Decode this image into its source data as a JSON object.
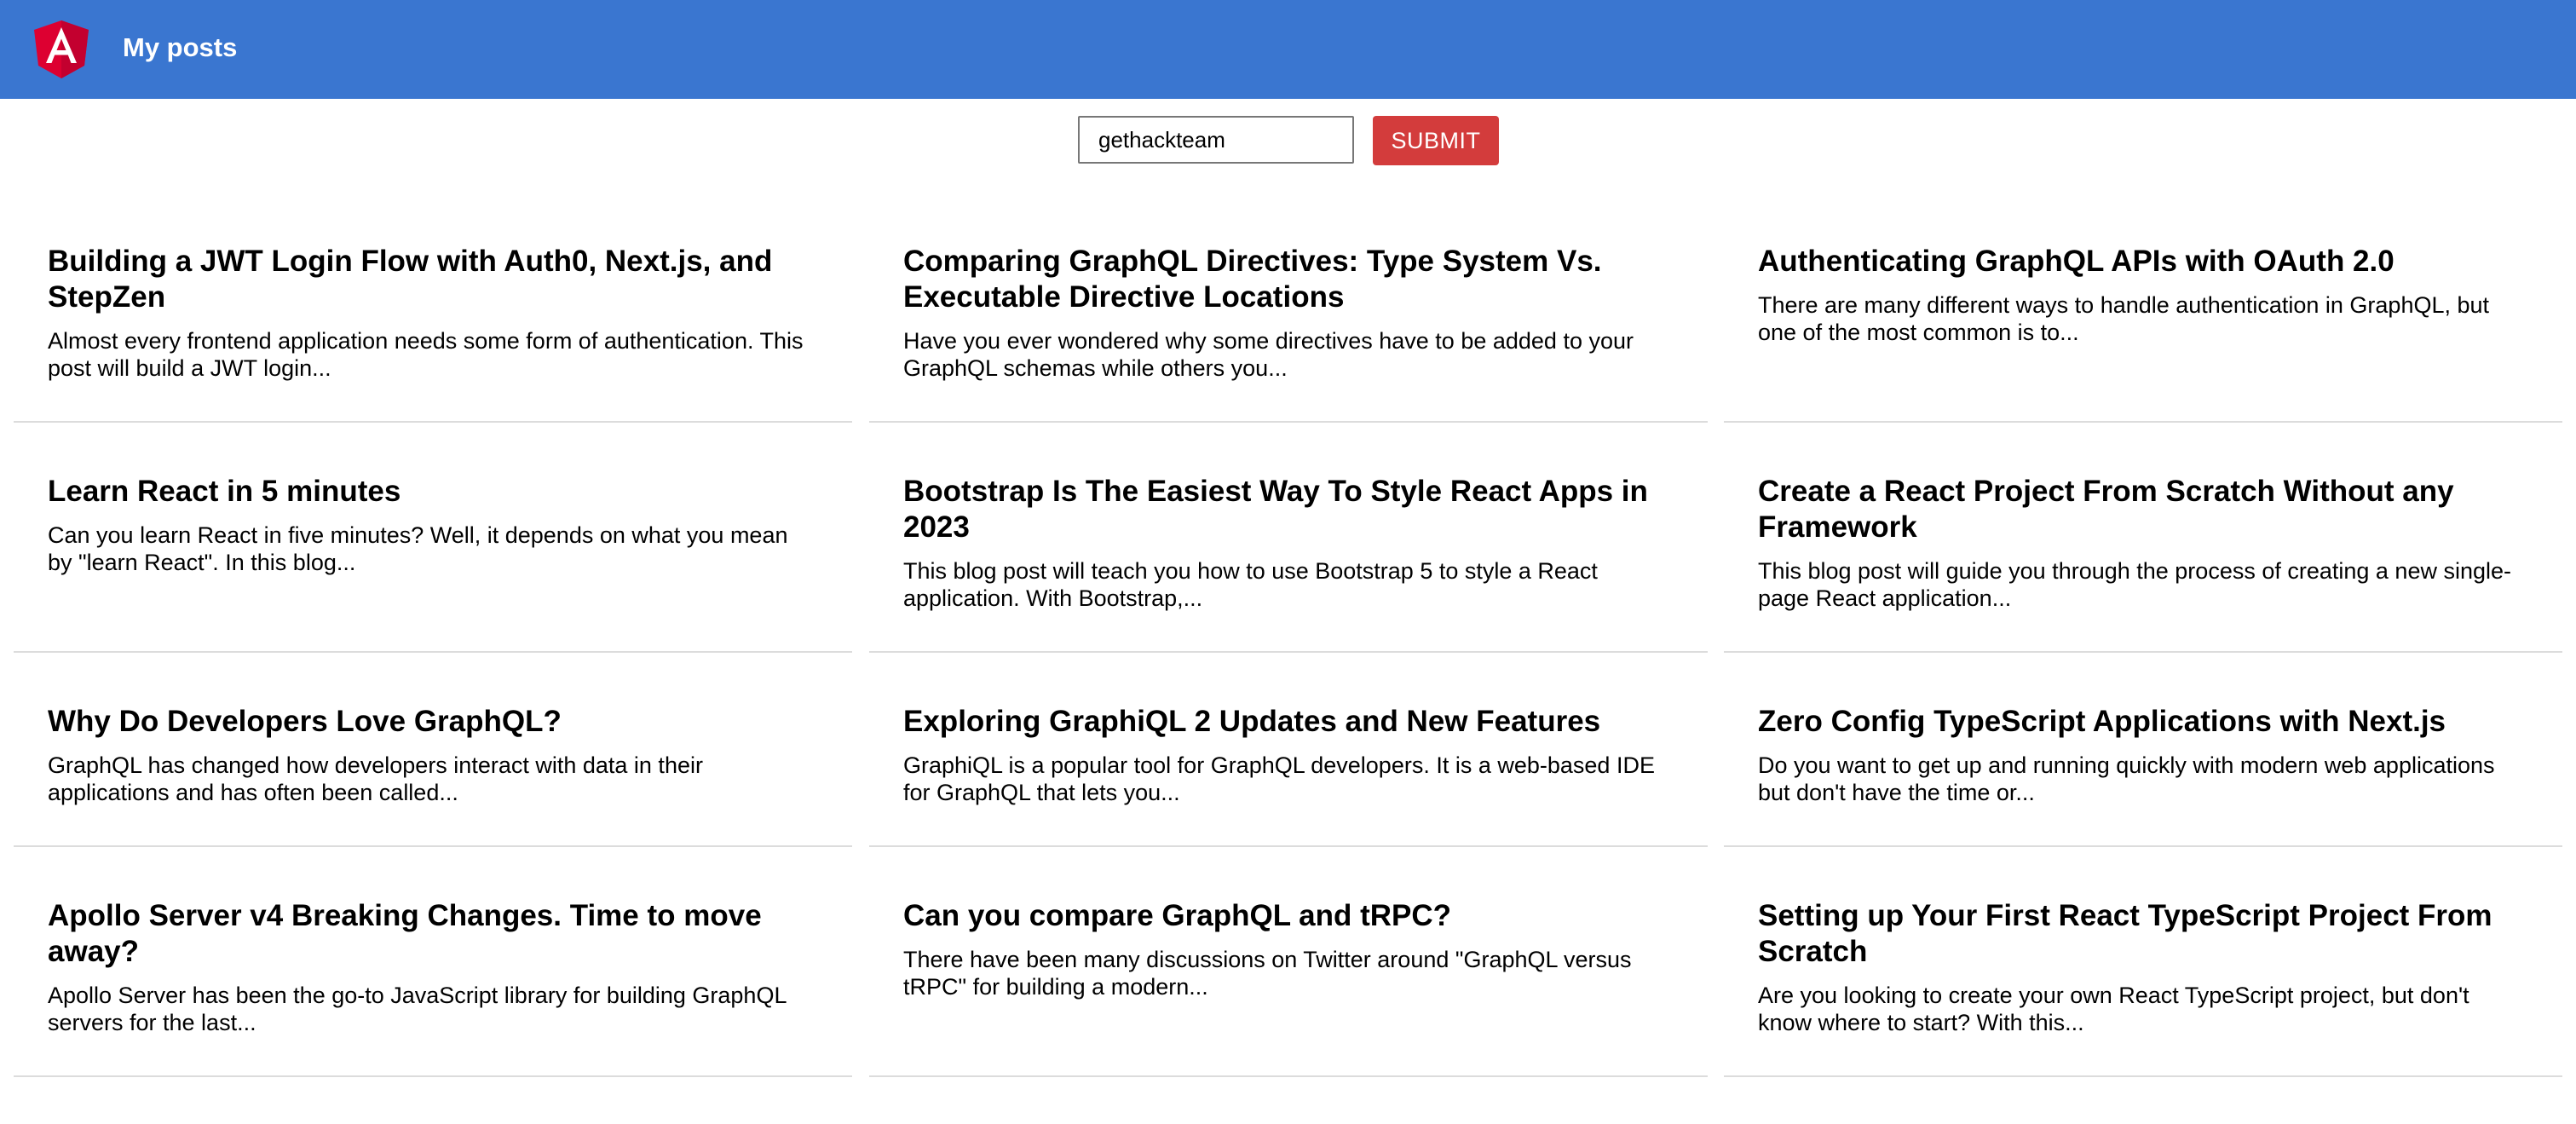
{
  "header": {
    "title": "My posts",
    "logo_icon": "angular-logo-icon",
    "bg_color": "#3a76d0"
  },
  "search": {
    "value": "gethackteam",
    "submit_label": "SUBMIT",
    "submit_color": "#d33c3c"
  },
  "posts": [
    {
      "title": "Building a JWT Login Flow with Auth0, Next.js, and StepZen",
      "excerpt": "Almost every frontend application needs some form of authentication. This post will build a JWT login..."
    },
    {
      "title": "Comparing GraphQL Directives: Type System Vs. Executable Directive Locations",
      "excerpt": "Have you ever wondered why some directives have to be added to your GraphQL schemas while others you..."
    },
    {
      "title": "Authenticating GraphQL APIs with OAuth 2.0",
      "excerpt": "There are many different ways to handle authentication in GraphQL, but one of the most common is to..."
    },
    {
      "title": "Learn React in 5 minutes",
      "excerpt": "Can you learn React in five minutes? Well, it depends on what you mean by \"learn React\". In this blog..."
    },
    {
      "title": "Bootstrap Is The Easiest Way To Style React Apps in 2023",
      "excerpt": "This blog post will teach you how to use Bootstrap 5 to style a React application. With Bootstrap,..."
    },
    {
      "title": "Create a React Project From Scratch Without any Framework",
      "excerpt": "This blog post will guide you through the process of creating a new single-page React application..."
    },
    {
      "title": "Why Do Developers Love GraphQL?",
      "excerpt": "GraphQL has changed how developers interact with data in their applications and has often been called..."
    },
    {
      "title": "Exploring GraphiQL 2 Updates and New Features",
      "excerpt": "GraphiQL is a popular tool for GraphQL developers. It is a web-based IDE for GraphQL that lets you..."
    },
    {
      "title": "Zero Config TypeScript Applications with Next.js",
      "excerpt": "Do you want to get up and running quickly with modern web applications but don't have the time or..."
    },
    {
      "title": "Apollo Server v4 Breaking Changes. Time to move away?",
      "excerpt": "Apollo Server has been the go-to JavaScript library for building GraphQL servers for the last..."
    },
    {
      "title": "Can you compare GraphQL and tRPC?",
      "excerpt": "There have been many discussions on Twitter around \"GraphQL versus tRPC\" for building a modern..."
    },
    {
      "title": "Setting up Your First React TypeScript Project From Scratch",
      "excerpt": "Are you looking to create your own React TypeScript project, but don't know where to start? With this..."
    }
  ]
}
